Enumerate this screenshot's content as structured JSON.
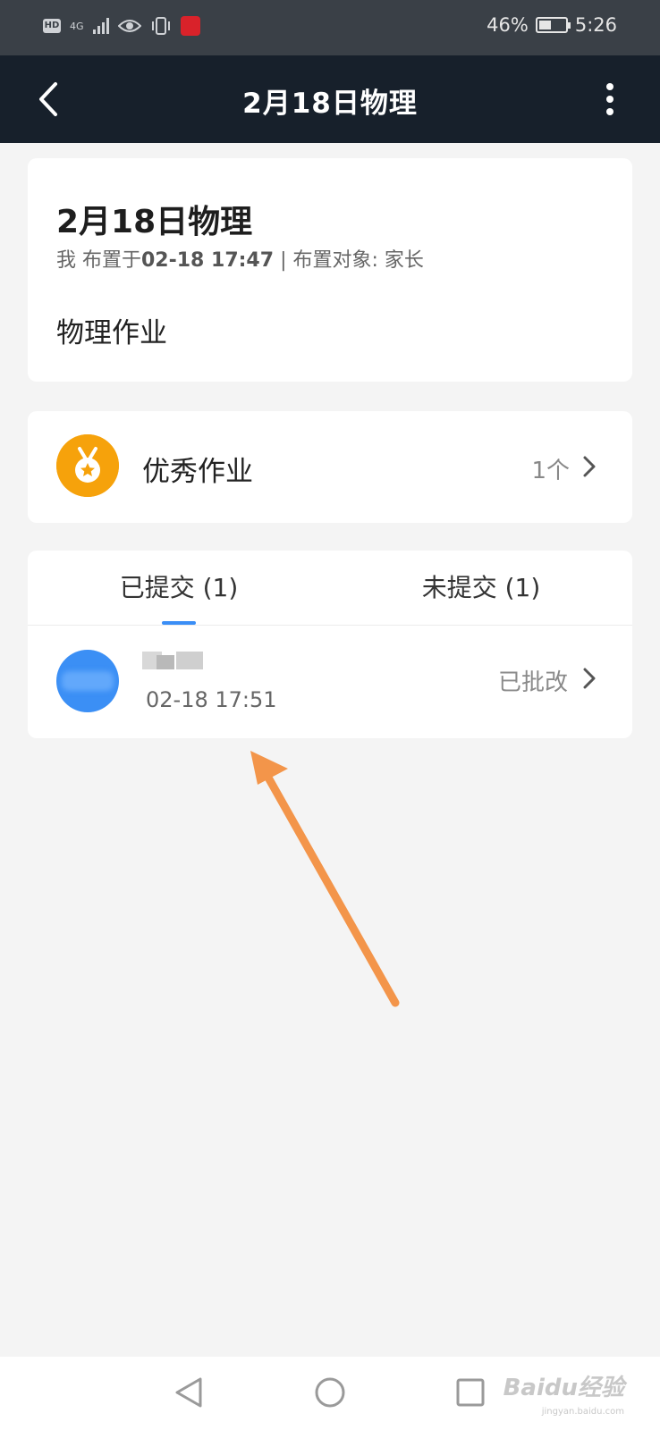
{
  "status_bar": {
    "hd": "HD",
    "network": "4G",
    "battery": "46%",
    "battery_level": 0.46,
    "time": "5:26"
  },
  "nav": {
    "title": "2月18日物理"
  },
  "assignment": {
    "title": "2月18日物理",
    "meta_prefix": "我 布置于",
    "meta_datetime": "02-18 17:47",
    "meta_target": "| 布置对象: 家长",
    "description": "物理作业"
  },
  "excellent": {
    "label": "优秀作业",
    "count": "1个"
  },
  "tabs": [
    {
      "label": "已提交 (1)",
      "active": true
    },
    {
      "label": "未提交 (1)",
      "active": false
    }
  ],
  "submissions": [
    {
      "time": "02-18 17:51",
      "status": "已批改"
    }
  ],
  "watermark": {
    "main": "Baidu经验",
    "sub": "jingyan.baidu.com"
  },
  "colors": {
    "accent": "#3a8ef6",
    "medal": "#f6a20b",
    "nav_bg": "#17202b",
    "annotation_arrow": "#f3954a"
  }
}
